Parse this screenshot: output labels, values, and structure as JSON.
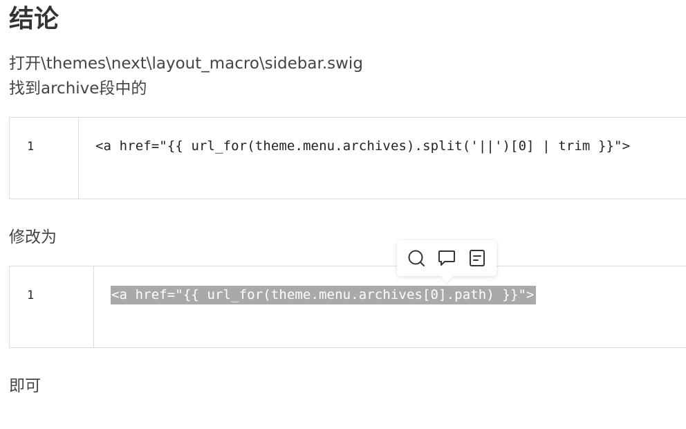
{
  "heading": "结论",
  "paragraphs": {
    "open_file": "打开\\themes\\next\\layout_macro\\sidebar.swig",
    "find_in_archive": "找到archive段中的",
    "change_to": "修改为",
    "done": "即可"
  },
  "code_blocks": [
    {
      "line_number": "1",
      "code": "<a href=\"{{ url_for(theme.menu.archives).split('||')[0] | trim }}\">"
    },
    {
      "line_number": "1",
      "code": "<a href=\"{{ url_for(theme.menu.archives[0].path) }}\">"
    }
  ],
  "selection_toolbar": {
    "icons": [
      "search-icon",
      "comment-icon",
      "note-icon"
    ]
  },
  "colors": {
    "selection_bg": "#a9a9a9",
    "border": "#dcdcdc",
    "text": "#404040"
  }
}
